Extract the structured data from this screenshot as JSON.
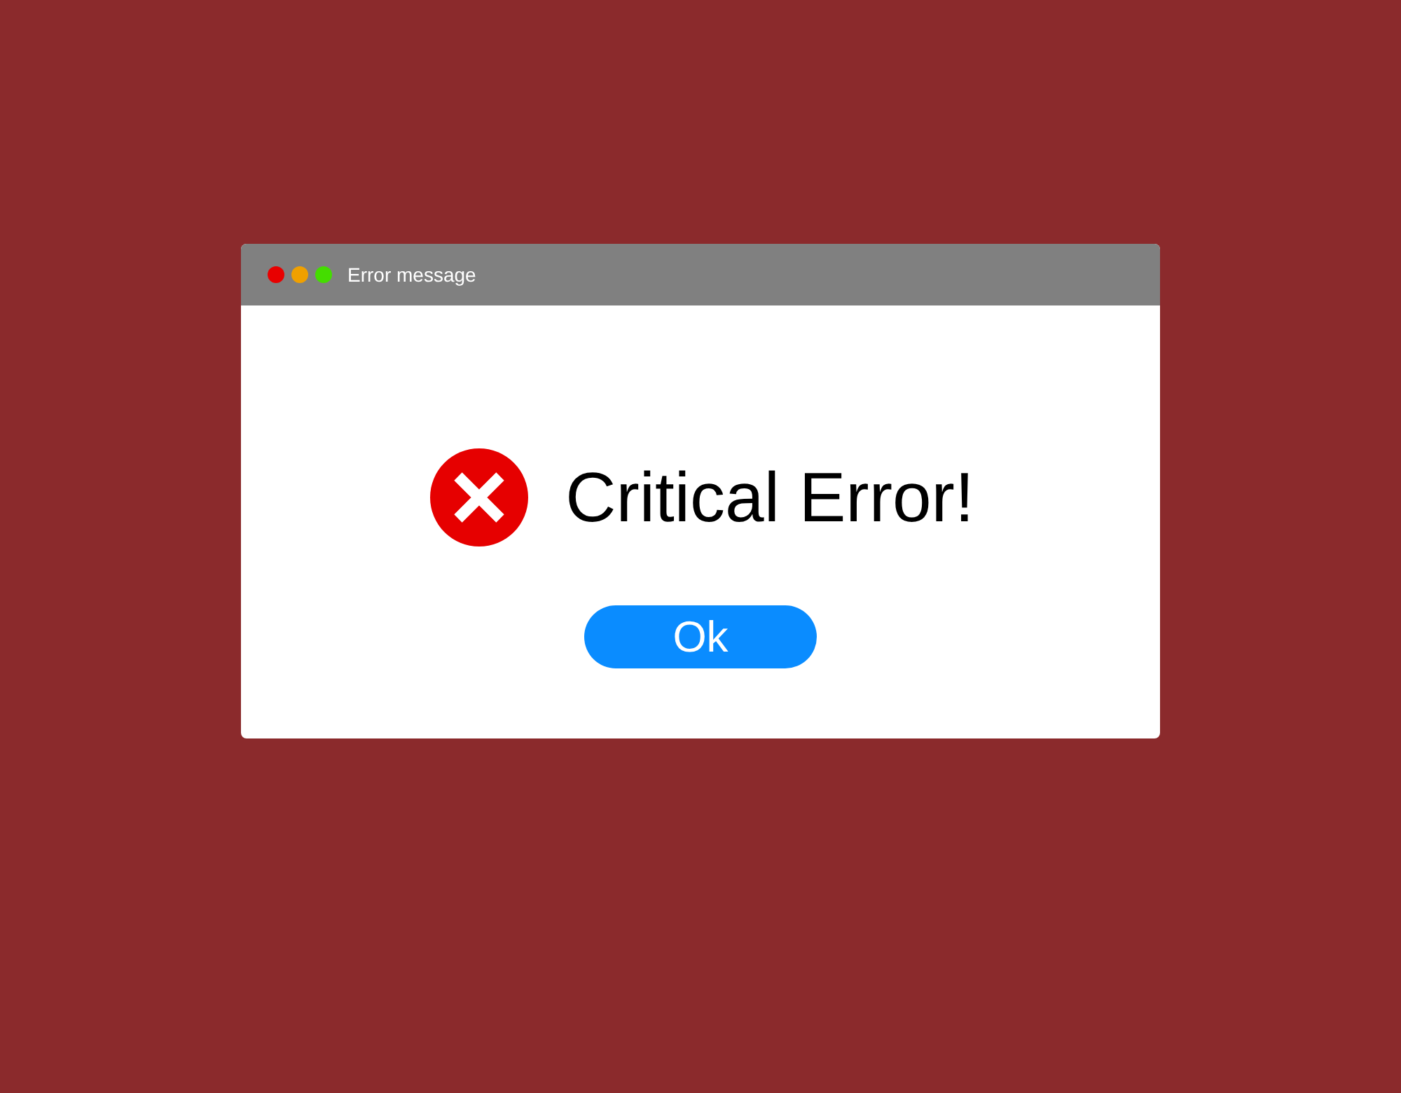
{
  "window": {
    "title": "Error message",
    "controls": [
      {
        "color": "#e80000"
      },
      {
        "color": "#f0a000"
      },
      {
        "color": "#44dd00"
      }
    ]
  },
  "message": {
    "kind": "error",
    "text": "Critical Error!"
  },
  "buttons": [
    "Ok"
  ]
}
